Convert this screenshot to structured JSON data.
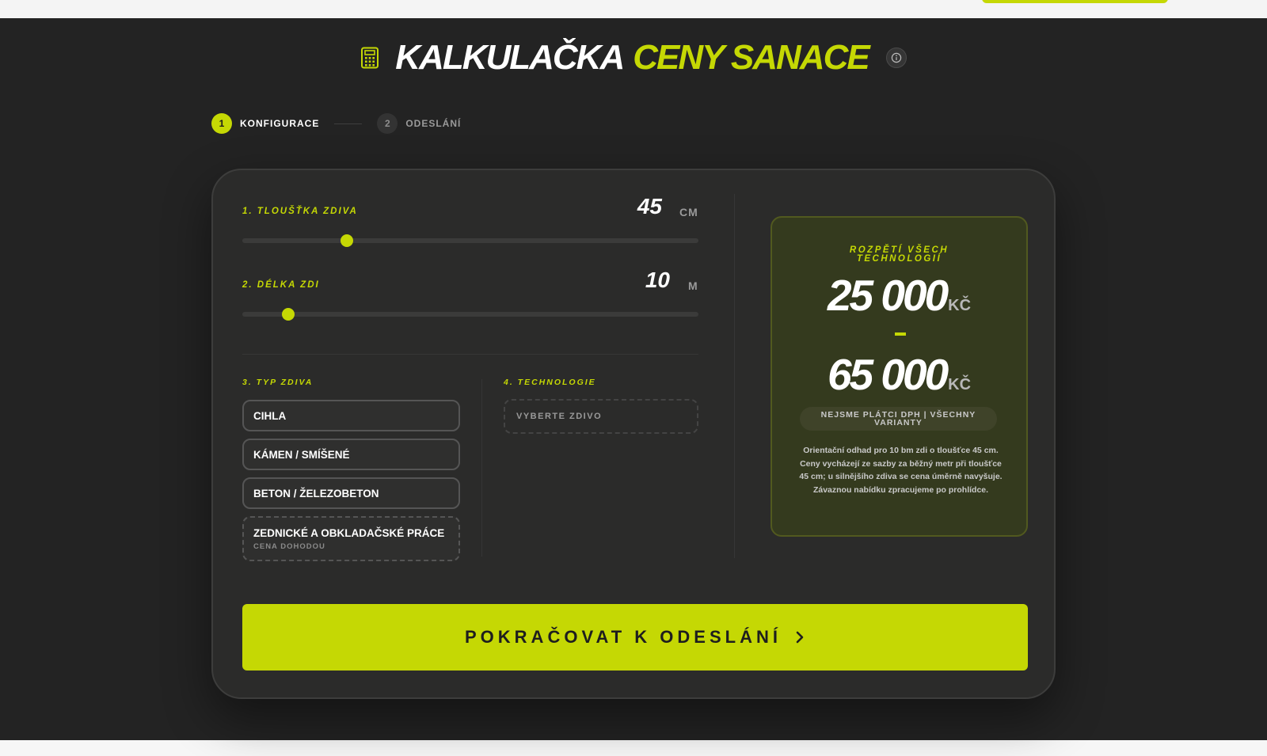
{
  "header": {
    "title_main": "KALKULAČKA",
    "title_accent": "CENY SANACE",
    "icon": "calculator-icon",
    "info_icon": "info-icon"
  },
  "steps": [
    {
      "number": "1",
      "label": "KONFIGURACE",
      "active": true
    },
    {
      "number": "2",
      "label": "ODESLÁNÍ",
      "active": false
    }
  ],
  "config": {
    "thickness": {
      "label": "1. TLOUŠŤKA ZDIVA",
      "value": "45",
      "unit": "CM",
      "slider_fraction": 0.23
    },
    "length": {
      "label": "2. DÉLKA ZDI",
      "value": "10",
      "unit": "M",
      "slider_fraction": 0.1
    },
    "masonry": {
      "label": "3. TYP ZDIVA",
      "options": [
        {
          "label": "CIHLA"
        },
        {
          "label": "KÁMEN / SMÍŠENÉ"
        },
        {
          "label": "BETON / ŽELEZOBETON"
        },
        {
          "label": "ZEDNICKÉ A OBKLADAČSKÉ PRÁCE",
          "sublabel": "CENA DOHODOU"
        }
      ]
    },
    "technology": {
      "label": "4. TECHNOLOGIE",
      "placeholder": "VYBERTE ZDIVO"
    }
  },
  "price": {
    "label": "ROZPĚTÍ VŠECH TECHNOLOGIÍ",
    "min": "25 000",
    "max": "65 000",
    "currency": "KČ",
    "dash": "–",
    "vat_note": "NEJSME PLÁTCI DPH | VŠECHNY VARIANTY",
    "note": "Orientační odhad pro 10 bm zdi o tloušťce 45 cm. Ceny vycházejí ze sazby za běžný metr při tloušťce 45 cm; u silnějšího zdiva se cena úměrně navyšuje. Závaznou nabídku zpracujeme po prohlídce."
  },
  "cta": {
    "label": "POKRAČOVAT K ODESLÁNÍ",
    "icon": "chevron-right-icon"
  },
  "colors": {
    "accent": "#c5d804",
    "background": "#232323",
    "card": "#2b2b2a"
  }
}
